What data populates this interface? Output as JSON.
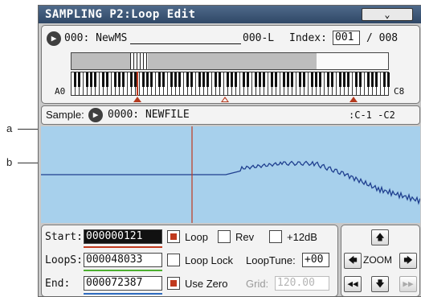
{
  "callouts": {
    "a": "a",
    "b": "b"
  },
  "header": {
    "title": "SAMPLING P2:Loop Edit",
    "menu_icon": "chevron-down-icon"
  },
  "multisample": {
    "label": "000: NewMS",
    "zone": "000-L",
    "index_label": "Index:",
    "index_value": "001",
    "index_total": "/ 008"
  },
  "keyboard": {
    "low_note": "A0",
    "high_note": "C8"
  },
  "sample": {
    "label": "Sample:",
    "name": "0000: NEWFILE",
    "range": ":C-1 -C2"
  },
  "loop": {
    "start_label": "Start:",
    "start_value": "000000121",
    "loops_label": "LoopS:",
    "loops_value": "000048033",
    "end_label": "End:",
    "end_value": "000072387",
    "loop_label": "Loop",
    "loop_on": true,
    "rev_label": "Rev",
    "rev_on": false,
    "plus12_label": "+12dB",
    "plus12_on": false,
    "looplock_label": "Loop Lock",
    "looplock_on": false,
    "looptune_label": "LoopTune:",
    "looptune_value": "+00",
    "usezero_label": "Use Zero",
    "usezero_on": true,
    "grid_label": "Grid:",
    "grid_value": "120.00"
  },
  "zoom": {
    "label": "ZOOM"
  },
  "colors": {
    "title": "#3d5677",
    "wave_bg": "#a7d0ec",
    "wave_line": "#1f3f8f",
    "marker": "#c0391e"
  }
}
